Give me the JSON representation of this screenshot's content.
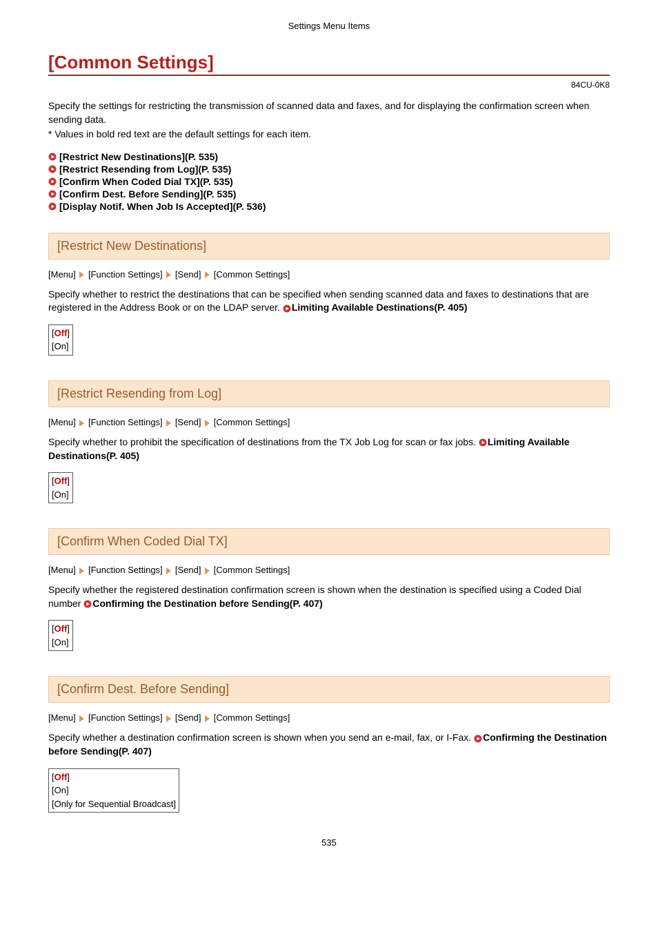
{
  "header_label": "Settings Menu Items",
  "main_title": "[Common Settings]",
  "doc_code": "84CU-0K8",
  "intro_line1": "Specify the settings for restricting the transmission of scanned data and faxes, and for displaying the confirmation screen when sending data.",
  "intro_line2": "* Values in bold red text are the default settings for each item.",
  "toc": [
    "[Restrict New Destinations](P. 535)",
    "[Restrict Resending from Log](P. 535)",
    "[Confirm When Coded Dial TX](P. 535)",
    "[Confirm Dest. Before Sending](P. 535)",
    "[Display Notif. When Job Is Accepted](P. 536)"
  ],
  "breadcrumb": {
    "p1": "[Menu]",
    "p2": "[Function Settings]",
    "p3": "[Send]",
    "p4": "[Common Settings]"
  },
  "section1": {
    "title": "[Restrict New Destinations]",
    "desc_pre": "Specify whether to restrict the destinations that can be specified when sending scanned data and faxes to destinations that are registered in the Address Book or on the LDAP server. ",
    "link": "Limiting Available Destinations(P. 405)",
    "opt_default": "Off",
    "opt_other": "[On]"
  },
  "section2": {
    "title": "[Restrict Resending from Log]",
    "desc_pre": "Specify whether to prohibit the specification of destinations from the TX Job Log for scan or fax jobs. ",
    "link": "Limiting Available Destinations(P. 405)",
    "opt_default": "Off",
    "opt_other": "[On]"
  },
  "section3": {
    "title": "[Confirm When Coded Dial TX]",
    "desc_pre": "Specify whether the registered destination confirmation screen is shown when the destination is specified using a Coded Dial number ",
    "link": "Confirming the Destination before Sending(P. 407)",
    "opt_default": "Off",
    "opt_other": "[On]"
  },
  "section4": {
    "title": "[Confirm Dest. Before Sending]",
    "desc_pre": "Specify whether a destination confirmation screen is shown when you send an e-mail, fax, or I-Fax. ",
    "link": "Confirming the Destination before Sending(P. 407)",
    "opt_default": "Off",
    "opt_other1": "[On]",
    "opt_other2": "[Only for Sequential Broadcast]"
  },
  "page_number": "535"
}
